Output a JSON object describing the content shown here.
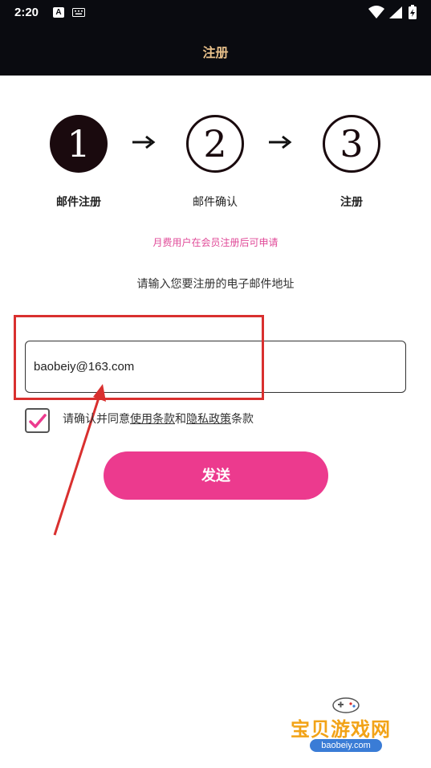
{
  "status_bar": {
    "time": "2:20",
    "app_icon_letter": "A"
  },
  "header": {
    "title": "注册"
  },
  "steps": [
    {
      "number": "1",
      "label": "邮件注册",
      "active": true
    },
    {
      "number": "2",
      "label": "邮件确认",
      "active": false
    },
    {
      "number": "3",
      "label": "注册",
      "active": false
    }
  ],
  "notice": "月费用户在会员注册后可申请",
  "instruction": "请输入您要注册的电子邮件地址",
  "email": {
    "value": "baobeiy@163.com"
  },
  "terms": {
    "prefix": "请确认并同意",
    "terms_link": "使用条款",
    "joiner": "和",
    "privacy_link": "隐私政策",
    "suffix": "条款",
    "checked": true
  },
  "send_button": {
    "label": "发送"
  },
  "watermark": {
    "title": "宝贝游戏网",
    "url": "baobeiy.com"
  },
  "colors": {
    "accent": "#ec3a8e",
    "header_bg": "#0a0b10",
    "title": "#e8c08a",
    "notice": "#e04a98",
    "annotation": "#d9302f"
  },
  "icons": [
    "keyboard-icon",
    "wifi-icon",
    "signal-icon",
    "battery-icon",
    "arrow-right-icon",
    "checkmark-icon",
    "gamepad-icon"
  ]
}
